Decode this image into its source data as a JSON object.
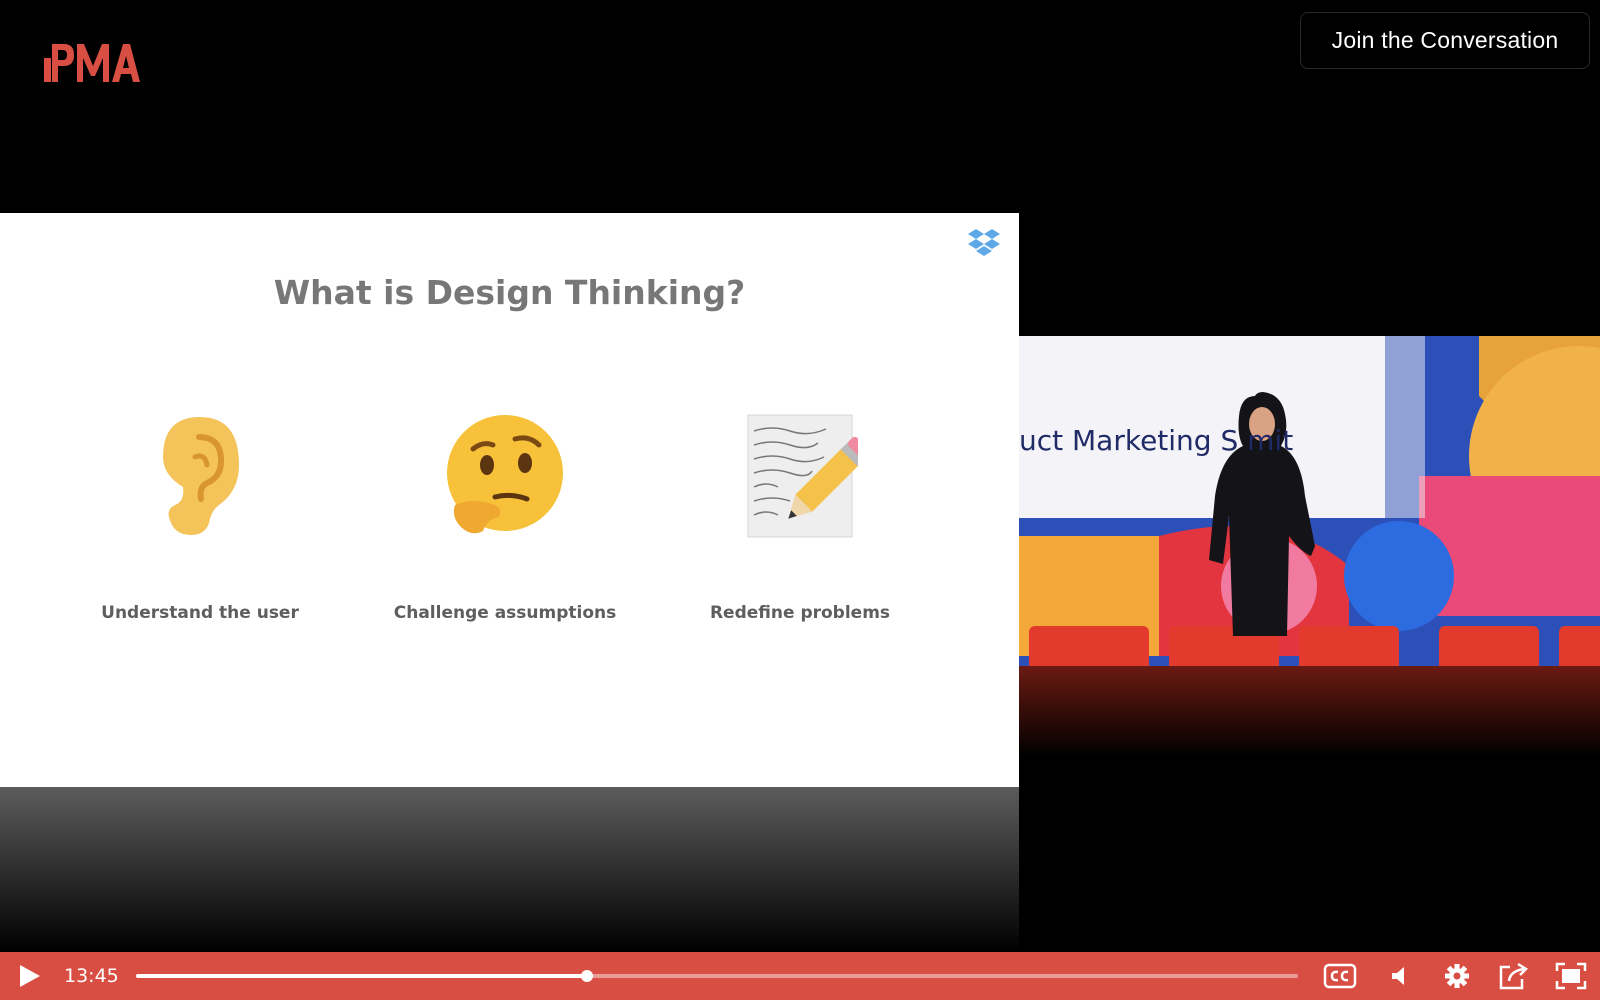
{
  "header": {
    "logo_text": "PMA",
    "join_label": "Join the Conversation"
  },
  "slide": {
    "title": "What is Design Thinking?",
    "items": [
      {
        "icon": "ear-icon",
        "label": "Understand the user"
      },
      {
        "icon": "thinking-face-icon",
        "label": "Challenge assumptions"
      },
      {
        "icon": "memo-pencil-icon",
        "label": "Redefine problems"
      }
    ]
  },
  "stage": {
    "backdrop_text": "uct Marketing S   mit"
  },
  "player": {
    "current_time": "13:45",
    "progress_fraction": 0.388,
    "icons": [
      "play-icon",
      "closed-captions-icon",
      "volume-icon",
      "settings-gear-icon",
      "share-icon",
      "fullscreen-icon"
    ]
  },
  "colors": {
    "brand": "#d84e43",
    "slide_text": "#5e5e5e"
  }
}
